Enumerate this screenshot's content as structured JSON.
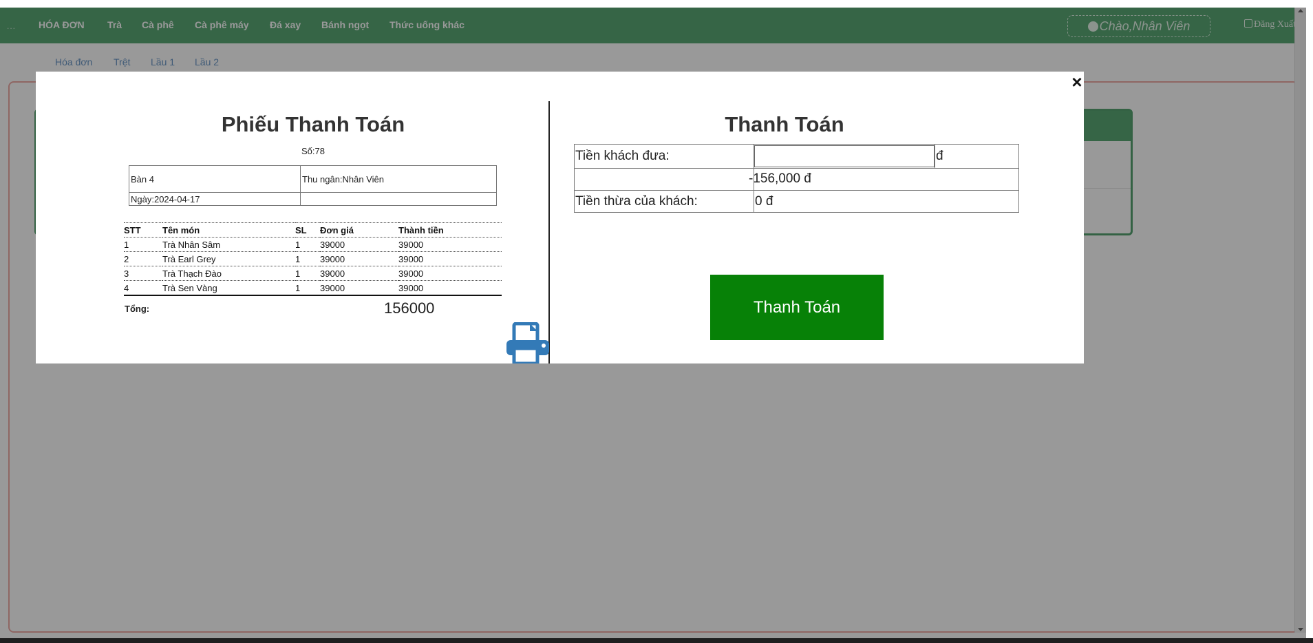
{
  "navbar": {
    "dots": "...",
    "items": [
      "HÓA ĐƠN",
      "Trà",
      "Cà phê",
      "Cà phê máy",
      "Đá xay",
      "Bánh ngọt",
      "Thức uống khác"
    ],
    "greeting": "Chào,Nhân Viên",
    "logout": "Đăng Xuất"
  },
  "subnav": {
    "items": [
      "Hóa đơn",
      "Trệt",
      "Lầu 1",
      "Lầu 2"
    ]
  },
  "modal": {
    "close_icon": "close-x-icon",
    "receipt": {
      "title": "Phiếu Thanh Toán",
      "number": "Số:78",
      "table_name": "Bàn 4",
      "cashier": "Thu ngân:Nhân Viên",
      "date": "Ngày:2024-04-17",
      "columns": [
        "STT",
        "Tên món",
        "SL",
        "Đơn giá",
        "Thành tiền"
      ],
      "rows": [
        [
          "1",
          "Trà Nhân Sâm",
          "1",
          "39000",
          "39000"
        ],
        [
          "2",
          "Trà Earl Grey",
          "1",
          "39000",
          "39000"
        ],
        [
          "3",
          "Trà Thạch Đào",
          "1",
          "39000",
          "39000"
        ],
        [
          "4",
          "Trà Sen Vàng",
          "1",
          "39000",
          "39000"
        ]
      ],
      "total_label": "Tổng:",
      "total_value": "156000",
      "print_icon": "printer-icon"
    },
    "payment": {
      "title": "Thanh Toán",
      "given_label": "Tiền khách đưa:",
      "given_value": "",
      "currency": "đ",
      "due_value": "-156,000 đ",
      "change_label": "Tiền thừa của khách:",
      "change_value": "0 đ",
      "button": "Thanh Toán"
    }
  },
  "colors": {
    "navbar": "#5aa875",
    "pay_button": "#078107",
    "print_icon": "#337ab7"
  }
}
